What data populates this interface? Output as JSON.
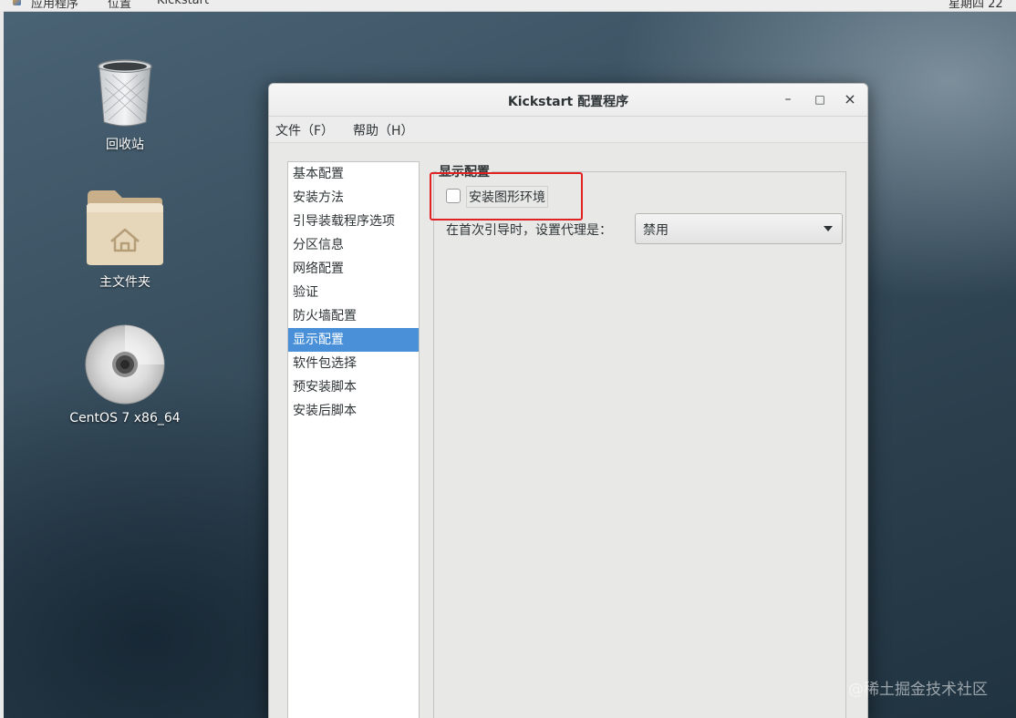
{
  "topbar": {
    "applications": "应用程序",
    "places": "位置",
    "active_app": "Kickstart",
    "clock": "星期四 22"
  },
  "desktop": {
    "icons": [
      {
        "label": "回收站",
        "icon": "trash-icon"
      },
      {
        "label": "主文件夹",
        "icon": "home-folder-icon"
      },
      {
        "label": "CentOS 7 x86_64",
        "icon": "optical-disc-icon"
      }
    ]
  },
  "window": {
    "title": "Kickstart 配置程序",
    "controls": {
      "minimize": "–",
      "maximize": "□",
      "close": "×"
    },
    "menu": [
      "文件（F）",
      "帮助（H）"
    ],
    "nav": {
      "items": [
        "基本配置",
        "安装方法",
        "引导装载程序选项",
        "分区信息",
        "网络配置",
        "验证",
        "防火墙配置",
        "显示配置",
        "软件包选择",
        "预安装脚本",
        "安装后脚本"
      ],
      "selected": "显示配置"
    },
    "display_config": {
      "section_title": "显示配置",
      "install_gui_label": "安装图形环境",
      "install_gui_checked": false,
      "first_boot_agent_label": "在首次引导时，设置代理是：",
      "first_boot_agent_value": "禁用"
    }
  },
  "colors": {
    "selection": "#4a90d9",
    "highlight_box": "#e02222"
  },
  "watermark": "@稀土掘金技术社区"
}
